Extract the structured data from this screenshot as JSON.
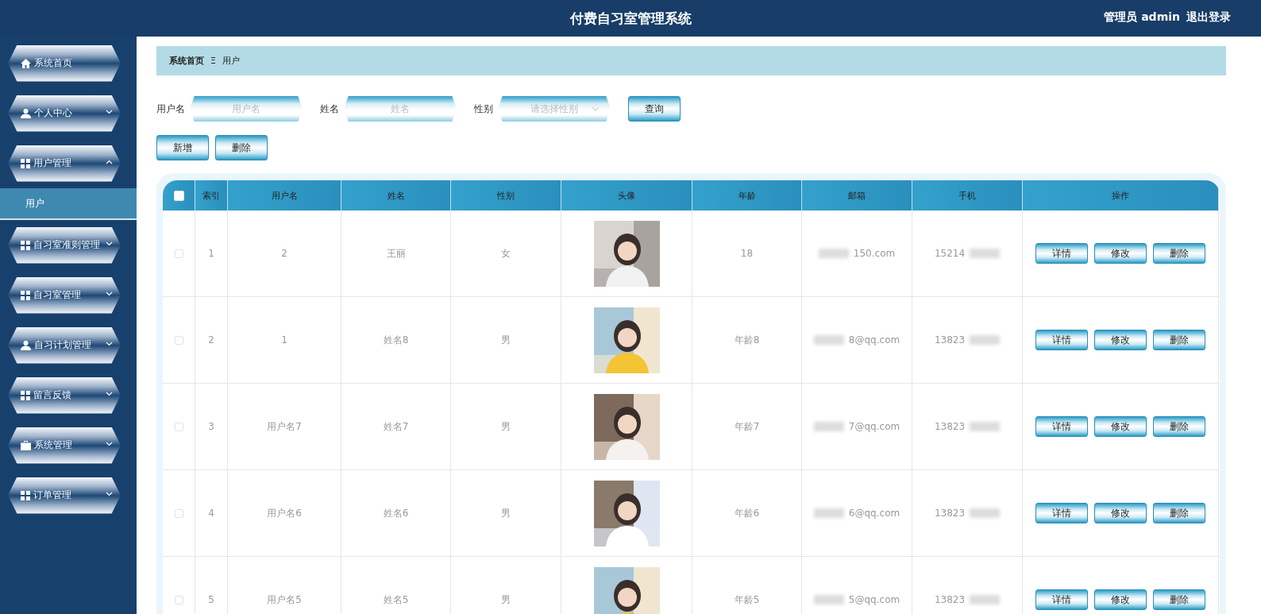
{
  "header": {
    "title": "付费自习室管理系统",
    "user": "管理员 admin",
    "logout": "退出登录"
  },
  "sidebar": {
    "items": [
      {
        "label": "系统首页",
        "kind": "home"
      },
      {
        "label": "个人中心",
        "kind": "user",
        "expanded": false
      },
      {
        "label": "用户管理",
        "kind": "grid",
        "expanded": true,
        "children": [
          {
            "label": "用户",
            "selected": true
          }
        ]
      },
      {
        "label": "自习室准则管理",
        "kind": "grid",
        "expanded": false
      },
      {
        "label": "自习室管理",
        "kind": "grid",
        "expanded": false
      },
      {
        "label": "自习计划管理",
        "kind": "user",
        "expanded": false
      },
      {
        "label": "留言反馈",
        "kind": "grid",
        "expanded": false
      },
      {
        "label": "系统管理",
        "kind": "briefcase",
        "expanded": false
      },
      {
        "label": "订单管理",
        "kind": "grid",
        "expanded": false
      }
    ]
  },
  "breadcrumb": {
    "home": "系统首页",
    "separator": "Ξ",
    "current": "用户"
  },
  "search": {
    "fields": [
      {
        "label": "用户名",
        "placeholder": "用户名",
        "kind": "input"
      },
      {
        "label": "姓名",
        "placeholder": "姓名",
        "kind": "input"
      },
      {
        "label": "性别",
        "placeholder": "请选择性别",
        "kind": "select"
      }
    ],
    "button": "查询"
  },
  "actions": [
    "新增",
    "删除"
  ],
  "table": {
    "select_all": {
      "checked": false
    },
    "columns": [
      "索引",
      "用户名",
      "姓名",
      "性别",
      "头像",
      "年龄",
      "邮箱",
      "手机",
      "操作"
    ],
    "rows": [
      {
        "checked": false,
        "index": "1",
        "username": "2",
        "name": "王丽",
        "gender": "女",
        "age": "18",
        "email": "150.com",
        "phone": "15214",
        "buttons": [
          "详情",
          "修改",
          "删除"
        ]
      },
      {
        "checked": false,
        "index": "2",
        "username": "1",
        "name": "姓名8",
        "gender": "男",
        "age": "年龄8",
        "email": "8@qq.com",
        "phone": "13823",
        "buttons": [
          "详情",
          "修改",
          "删除"
        ]
      },
      {
        "checked": false,
        "index": "3",
        "username": "用户名7",
        "name": "姓名7",
        "gender": "男",
        "age": "年龄7",
        "email": "7@qq.com",
        "phone": "13823",
        "buttons": [
          "详情",
          "修改",
          "删除"
        ]
      },
      {
        "checked": false,
        "index": "4",
        "username": "用户名6",
        "name": "姓名6",
        "gender": "男",
        "age": "年龄6",
        "email": "6@qq.com",
        "phone": "13823",
        "buttons": [
          "详情",
          "修改",
          "删除"
        ]
      },
      {
        "checked": false,
        "index": "5",
        "username": "用户名5",
        "name": "姓名5",
        "gender": "男",
        "age": "年龄5",
        "email": "5@qq.com",
        "phone": "13823",
        "buttons": [
          "详情",
          "修改",
          "删除"
        ]
      }
    ]
  }
}
